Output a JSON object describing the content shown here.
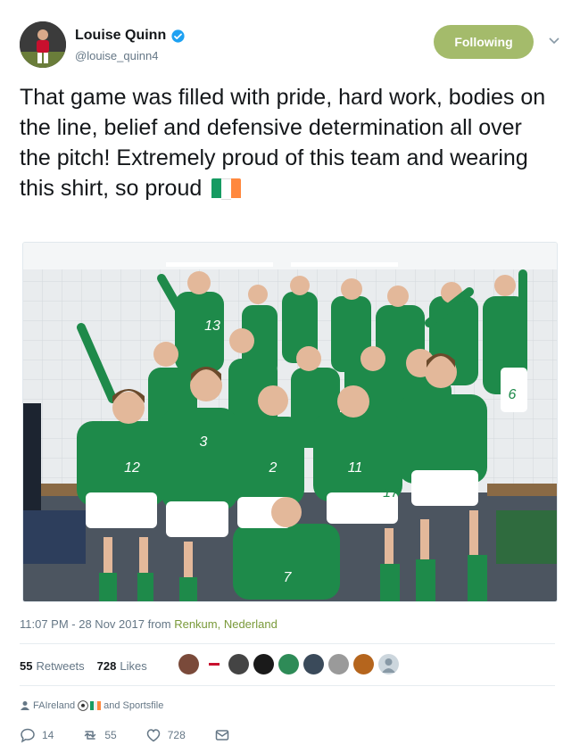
{
  "user": {
    "display_name": "Louise Quinn",
    "handle": "@louise_quinn4",
    "follow_label": "Following"
  },
  "tweet": {
    "text": "That game was filled with pride, hard work, bodies on the line, belief and defensive determination all over the pitch! Extremely proud of this team and wearing this shirt, so proud",
    "flag_emoji": "🇮🇪",
    "time": "11:07 PM - 28 Nov 2017",
    "from_label": "from",
    "location": "Renkum, Nederland",
    "photo_jersey_numbers": [
      "13",
      "12",
      "3",
      "2",
      "11",
      "7",
      "6",
      "17"
    ]
  },
  "stats": {
    "retweets_count": "55",
    "retweets_label": "Retweets",
    "likes_count": "728",
    "likes_label": "Likes"
  },
  "tags": {
    "first": "FAIreland",
    "emojis": "⚽🇮🇪",
    "second": "and Sportsfile"
  },
  "actions": {
    "replies": "14",
    "retweets": "55",
    "likes": "728"
  },
  "colors": {
    "follow_button": "#a4bb6b",
    "location_link": "#7a9a3a",
    "verified": "#1da1f2",
    "jersey_green": "#1e8a4a"
  },
  "icons": [
    "verified-badge-icon",
    "chevron-down-icon",
    "person-tag-icon",
    "reply-icon",
    "retweet-icon",
    "like-icon",
    "message-icon"
  ]
}
